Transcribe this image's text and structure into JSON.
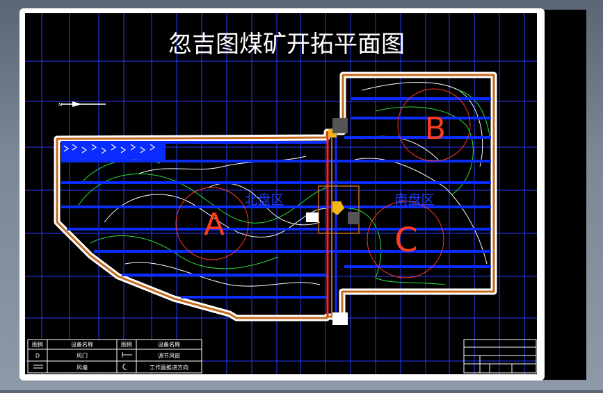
{
  "title": "忽吉图煤矿开拓平面图",
  "zones": {
    "north_label": "北盘区",
    "south_label": "南盘区",
    "marker_a": "A",
    "marker_b": "B",
    "marker_c": "C"
  },
  "legend": {
    "header_symbol_1": "图例",
    "header_name_1": "设备名称",
    "header_symbol_2": "图例",
    "header_name_2": "设备名称",
    "row1_symbol": "D",
    "row1_name": "风门",
    "row1_name_2": "调节风窗",
    "row2_name": "风墙",
    "row2_name_2": "工作面推进方向"
  },
  "colors": {
    "background": "#000000",
    "roadway": "#0b2cff",
    "grid": "#2a3cff",
    "boundary": "#c46a1c",
    "shaft": "#ff2020",
    "marker": "#ff3c1e",
    "contour_green": "#27e43a",
    "contour_white": "#ffffff",
    "label": "#1e3cff"
  }
}
